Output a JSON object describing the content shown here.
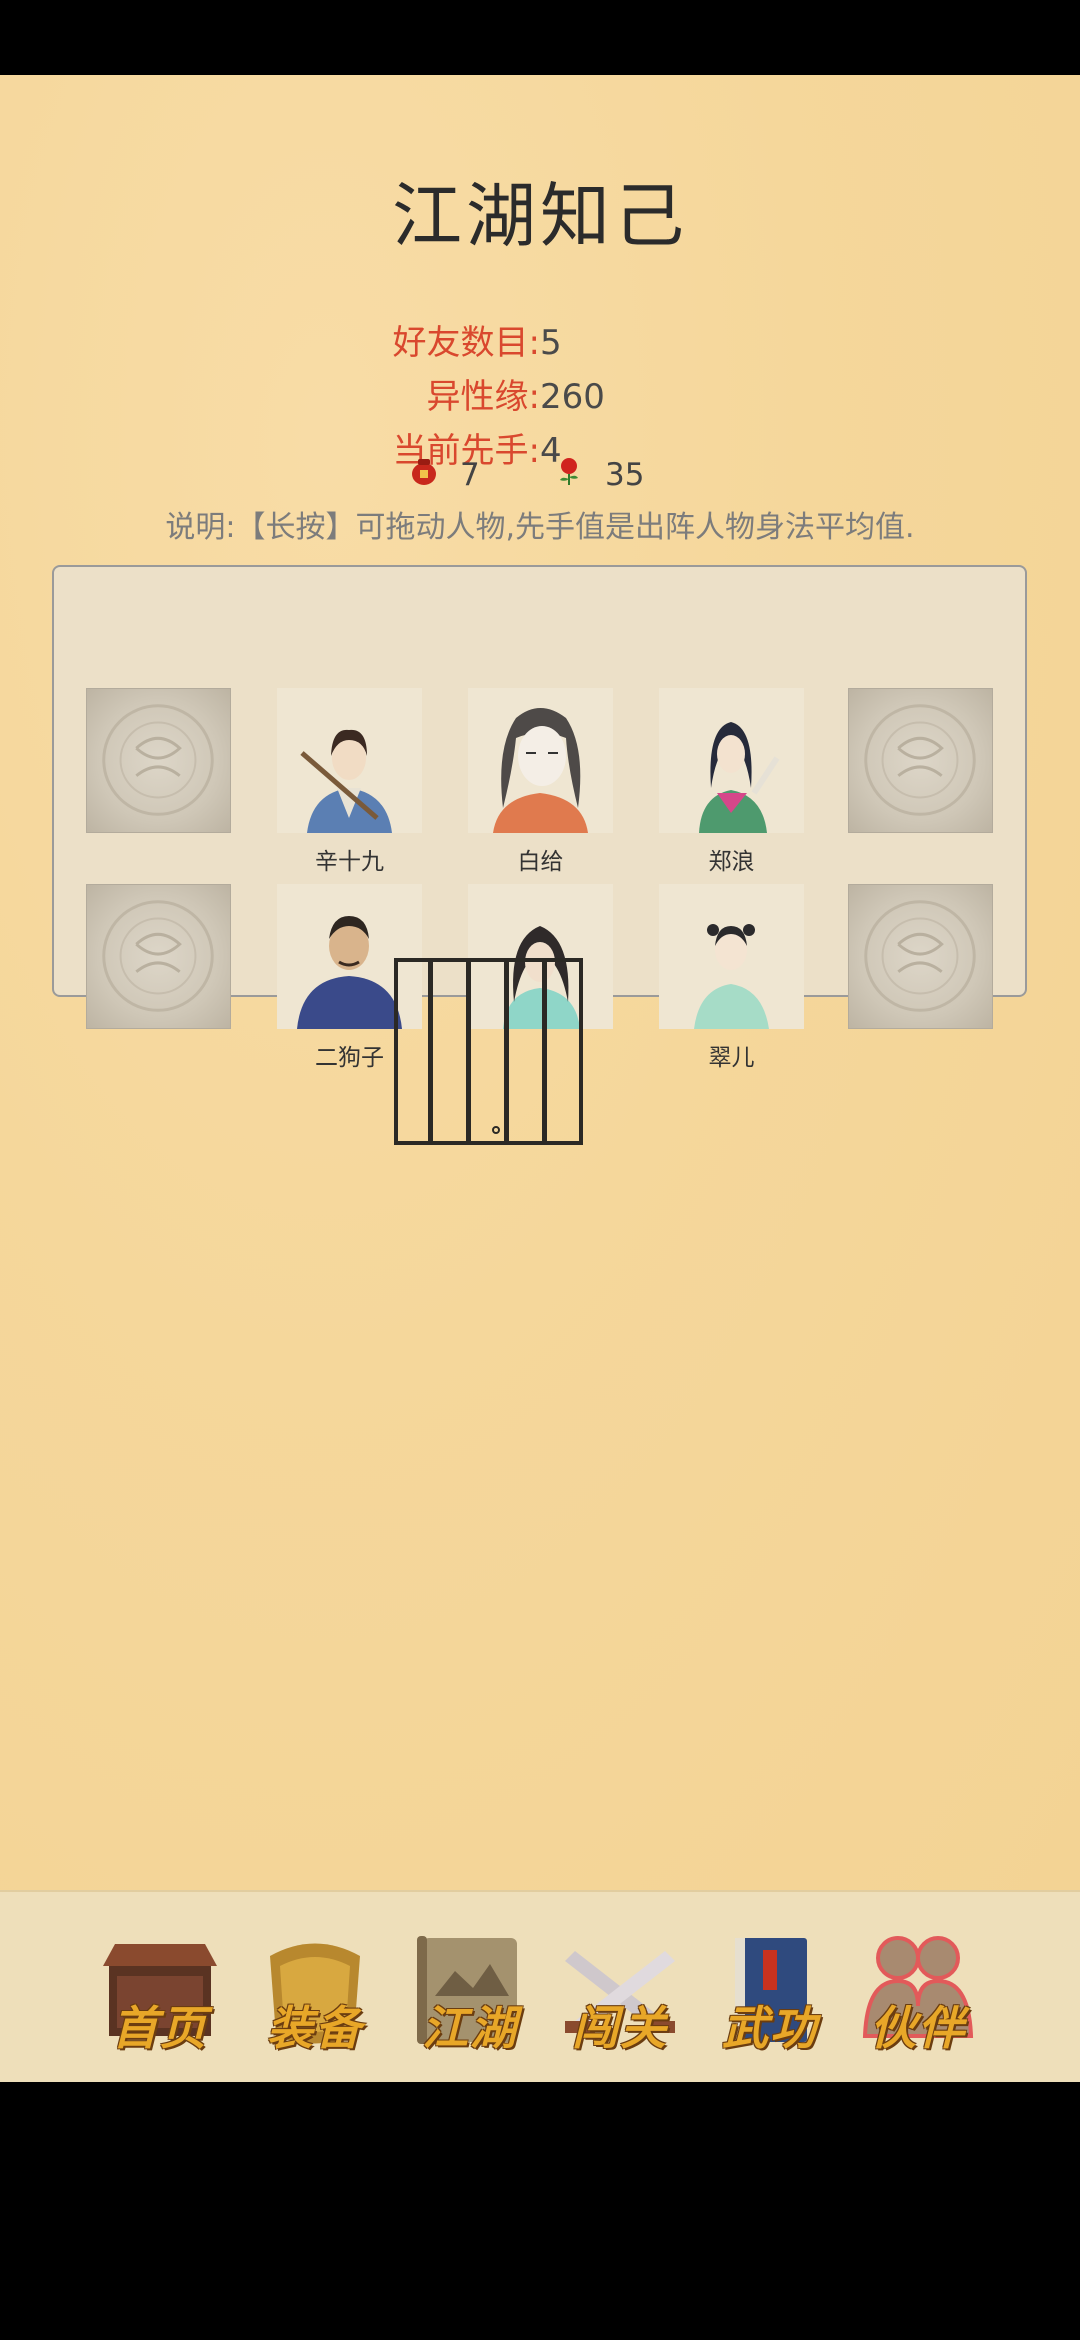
{
  "title": "江湖知己",
  "stats": [
    {
      "label": "好友数目:",
      "value": "5"
    },
    {
      "label": "异性缘:",
      "value": "260"
    },
    {
      "label": "当前先手:",
      "value": "4"
    }
  ],
  "resources": {
    "wine": "7",
    "rose": "35"
  },
  "note": "说明:【长按】可拖动人物,先手值是出阵人物身法平均值.",
  "characters": [
    {
      "name": "辛十九"
    },
    {
      "name": "白给"
    },
    {
      "name": "郑浪"
    },
    {
      "name": "二狗子"
    },
    {
      "name": "翠儿"
    }
  ],
  "nav": [
    {
      "label": "首页",
      "icon": "house-icon"
    },
    {
      "label": "装备",
      "icon": "armor-icon"
    },
    {
      "label": "江湖",
      "icon": "scroll-map-icon"
    },
    {
      "label": "闯关",
      "icon": "crossed-swords-icon"
    },
    {
      "label": "武功",
      "icon": "martial-book-icon"
    },
    {
      "label": "伙伴",
      "icon": "partners-icon",
      "active": true
    }
  ],
  "colors": {
    "accent": "#d9482e",
    "nav_label": "#e8a728",
    "background": "#f5d79b"
  }
}
